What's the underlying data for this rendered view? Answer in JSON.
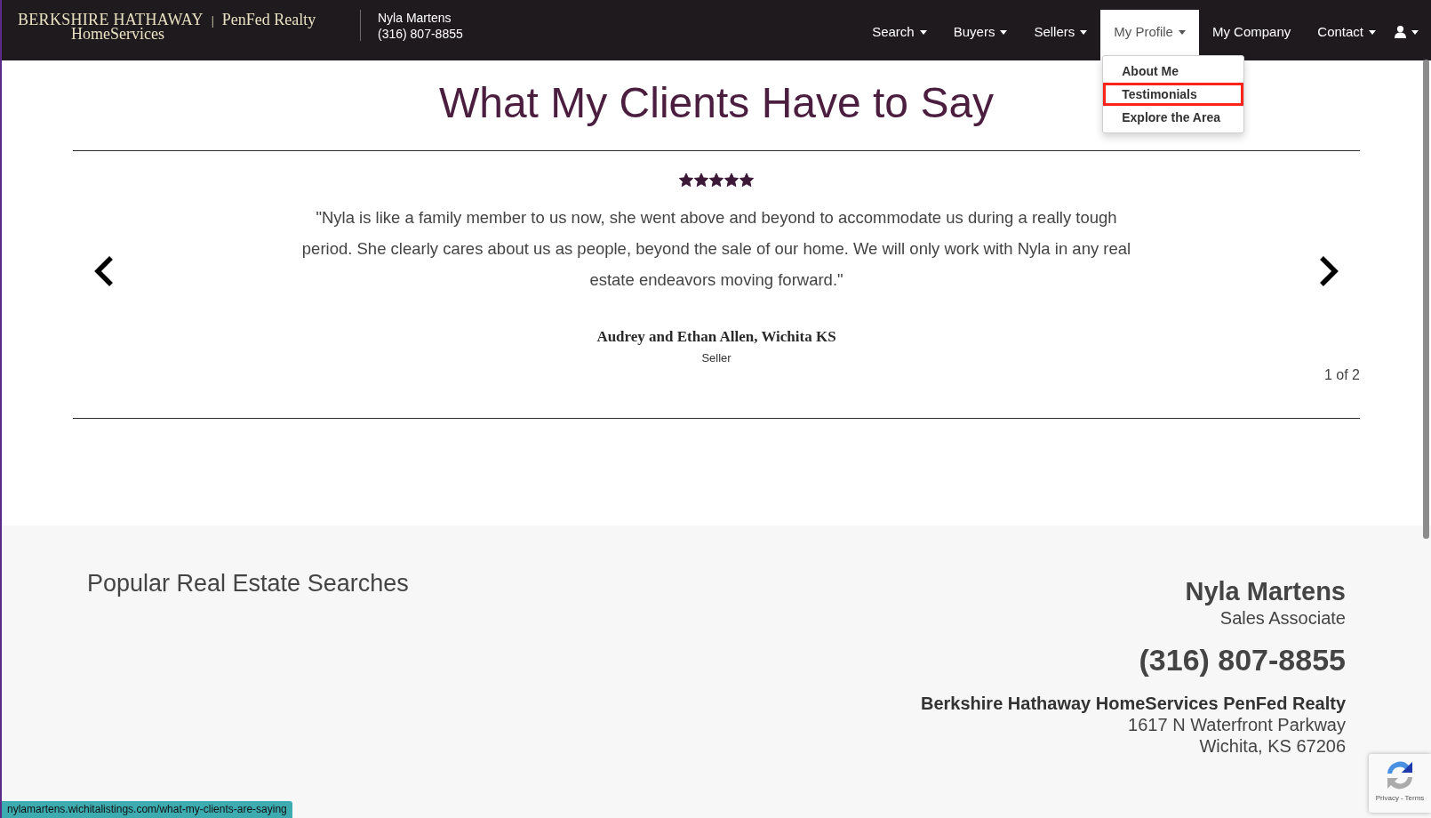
{
  "header": {
    "logo": {
      "line1": "BERKSHIRE HATHAWAY",
      "separator": "|",
      "brand": "PenFed Realty",
      "line2": "HomeServices"
    },
    "agent": {
      "name": "Nyla Martens",
      "phone": "(316) 807-8855"
    },
    "nav": [
      {
        "kind": "dropdown",
        "label": "Search",
        "selected": false
      },
      {
        "kind": "dropdown",
        "label": "Buyers",
        "selected": false
      },
      {
        "kind": "dropdown",
        "label": "Sellers",
        "selected": false
      },
      {
        "kind": "dropdown",
        "label": "My Profile",
        "selected": true,
        "menu": [
          {
            "label": "About Me",
            "highlighted": false
          },
          {
            "label": "Testimonials",
            "highlighted": true
          },
          {
            "label": "Explore the Area",
            "highlighted": false
          }
        ]
      },
      {
        "kind": "link",
        "label": "My Company",
        "selected": false
      },
      {
        "kind": "dropdown",
        "label": "Contact",
        "selected": false
      },
      {
        "kind": "account",
        "selected": false
      }
    ]
  },
  "testimonials": {
    "heading": "What My Clients Have to Say",
    "stars": 5,
    "quote": "\"Nyla is like a family member to us now, she went above and beyond to accommodate us during a really tough period. She clearly cares about us as people, beyond the sale of our home. We will only work with Nyla in any real estate endeavors moving forward.\"",
    "author": "Audrey and Ethan Allen, Wichita KS",
    "role": "Seller",
    "pager": "1 of 2"
  },
  "footer": {
    "popular_heading": "Popular Real Estate Searches",
    "agent": {
      "name": "Nyla Martens",
      "title": "Sales Associate",
      "phone": "(316) 807-8855",
      "company": "Berkshire Hathaway HomeServices PenFed Realty",
      "address_line1": "1617 N Waterfront Parkway",
      "address_line2": "Wichita, KS 67206"
    }
  },
  "recaptcha": {
    "links": [
      "Privacy",
      "Terms"
    ],
    "separator": "-"
  },
  "status_bar": {
    "url": "nylamartens.wichitalistings.com/what-my-clients-are-saying"
  }
}
